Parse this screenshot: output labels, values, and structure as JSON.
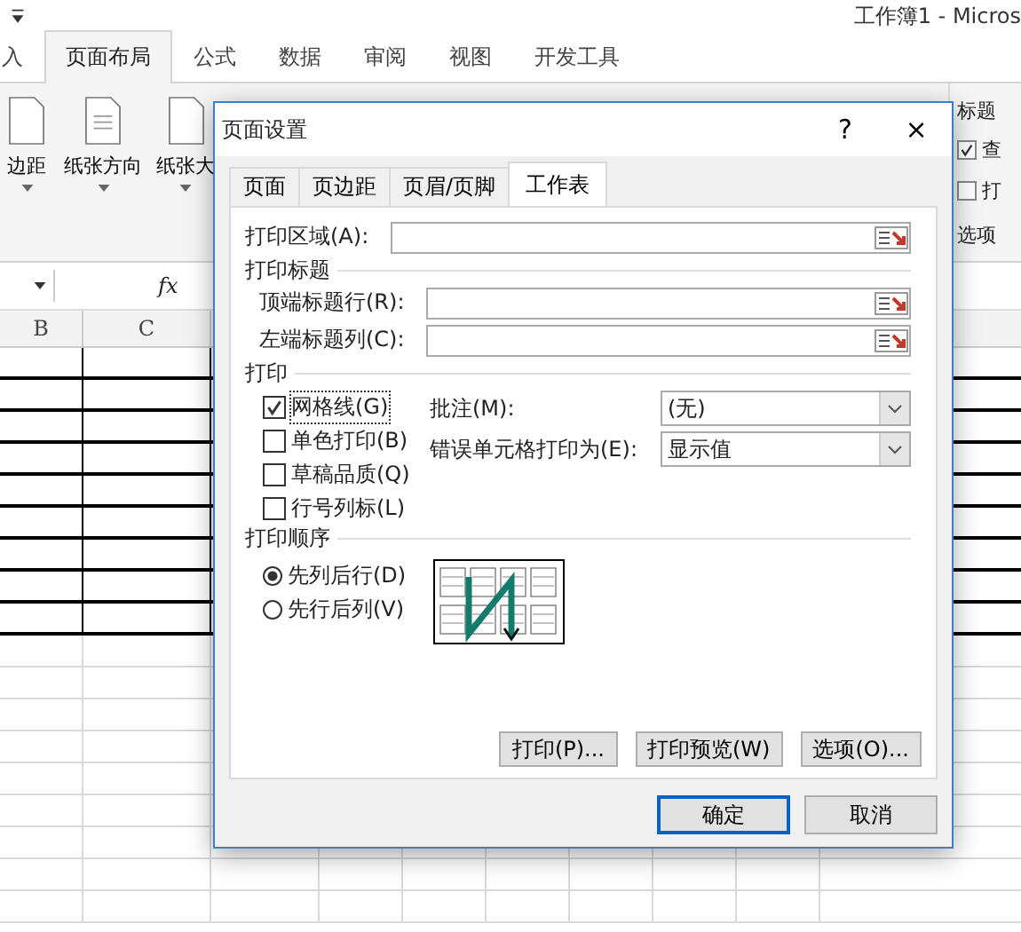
{
  "window": {
    "title": "工作簿1 - Micros"
  },
  "ribbon_tabs": [
    {
      "label": "入",
      "selected": false
    },
    {
      "label": "页面布局",
      "selected": true
    },
    {
      "label": "公式",
      "selected": false
    },
    {
      "label": "数据",
      "selected": false
    },
    {
      "label": "审阅",
      "selected": false
    },
    {
      "label": "视图",
      "selected": false
    },
    {
      "label": "开发工具",
      "selected": false
    }
  ],
  "ribbon_buttons": [
    {
      "label": "边距"
    },
    {
      "label": "纸张方向"
    },
    {
      "label": "纸张大"
    }
  ],
  "sheet_options": {
    "group_title": "标题",
    "items": [
      {
        "label": "查",
        "checked": true
      },
      {
        "label": "打",
        "checked": false
      }
    ],
    "group_label": "选项"
  },
  "formula_bar": {
    "fx": "fx"
  },
  "columns": [
    "B",
    "C"
  ],
  "dialog": {
    "title": "页面设置",
    "help": "?",
    "close": "×",
    "tabs": [
      {
        "label": "页面",
        "selected": false
      },
      {
        "label": "页边距",
        "selected": false
      },
      {
        "label": "页眉/页脚",
        "selected": false
      },
      {
        "label": "工作表",
        "selected": true
      }
    ],
    "print_area": {
      "label": "打印区域(A):"
    },
    "print_titles": {
      "heading": "打印标题",
      "fields": [
        {
          "label": "顶端标题行(R):"
        },
        {
          "label": "左端标题列(C):"
        }
      ]
    },
    "print": {
      "heading": "打印",
      "options": [
        {
          "label": "网格线(G)",
          "checked": true
        },
        {
          "label": "单色打印(B)",
          "checked": false
        },
        {
          "label": "草稿品质(Q)",
          "checked": false
        },
        {
          "label": "行号列标(L)",
          "checked": false
        }
      ],
      "selects": [
        {
          "label": "批注(M):",
          "value": "(无)"
        },
        {
          "label": "错误单元格打印为(E):",
          "value": "显示值"
        }
      ]
    },
    "order": {
      "heading": "打印顺序",
      "options": [
        {
          "label": "先列后行(D)",
          "selected": true
        },
        {
          "label": "先行后列(V)",
          "selected": false
        }
      ]
    },
    "buttons": [
      {
        "label": "打印(P)..."
      },
      {
        "label": "打印预览(W)"
      },
      {
        "label": "选项(O)..."
      }
    ],
    "footer_buttons": [
      {
        "label": "确定",
        "default": true
      },
      {
        "label": "取消",
        "default": false
      }
    ]
  }
}
